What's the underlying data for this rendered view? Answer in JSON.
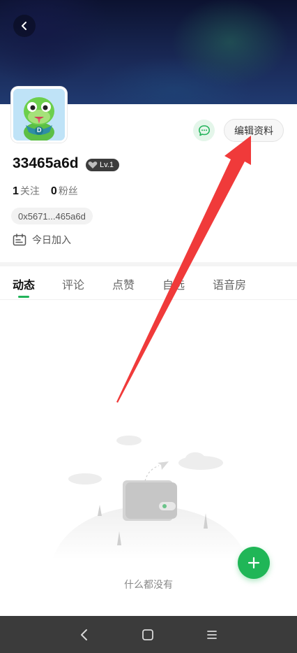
{
  "profile": {
    "username": "33465a6d",
    "level": "Lv.1",
    "following_count": "1",
    "following_label": "关注",
    "followers_count": "0",
    "followers_label": "粉丝",
    "address": "0x5671...465a6d",
    "joined": "今日加入",
    "avatar_letter": "D"
  },
  "header": {
    "edit_label": "编辑资料"
  },
  "tabs": [
    {
      "label": "动态"
    },
    {
      "label": "评论"
    },
    {
      "label": "点赞"
    },
    {
      "label": "自选"
    },
    {
      "label": "语音房"
    }
  ],
  "empty": {
    "text": "什么都没有"
  },
  "colors": {
    "accent": "#20b657",
    "annotation_arrow": "#f03a3a"
  },
  "icons": {
    "back": "back-icon",
    "message": "message-icon",
    "calendar": "calendar-icon",
    "add": "plus-icon"
  }
}
